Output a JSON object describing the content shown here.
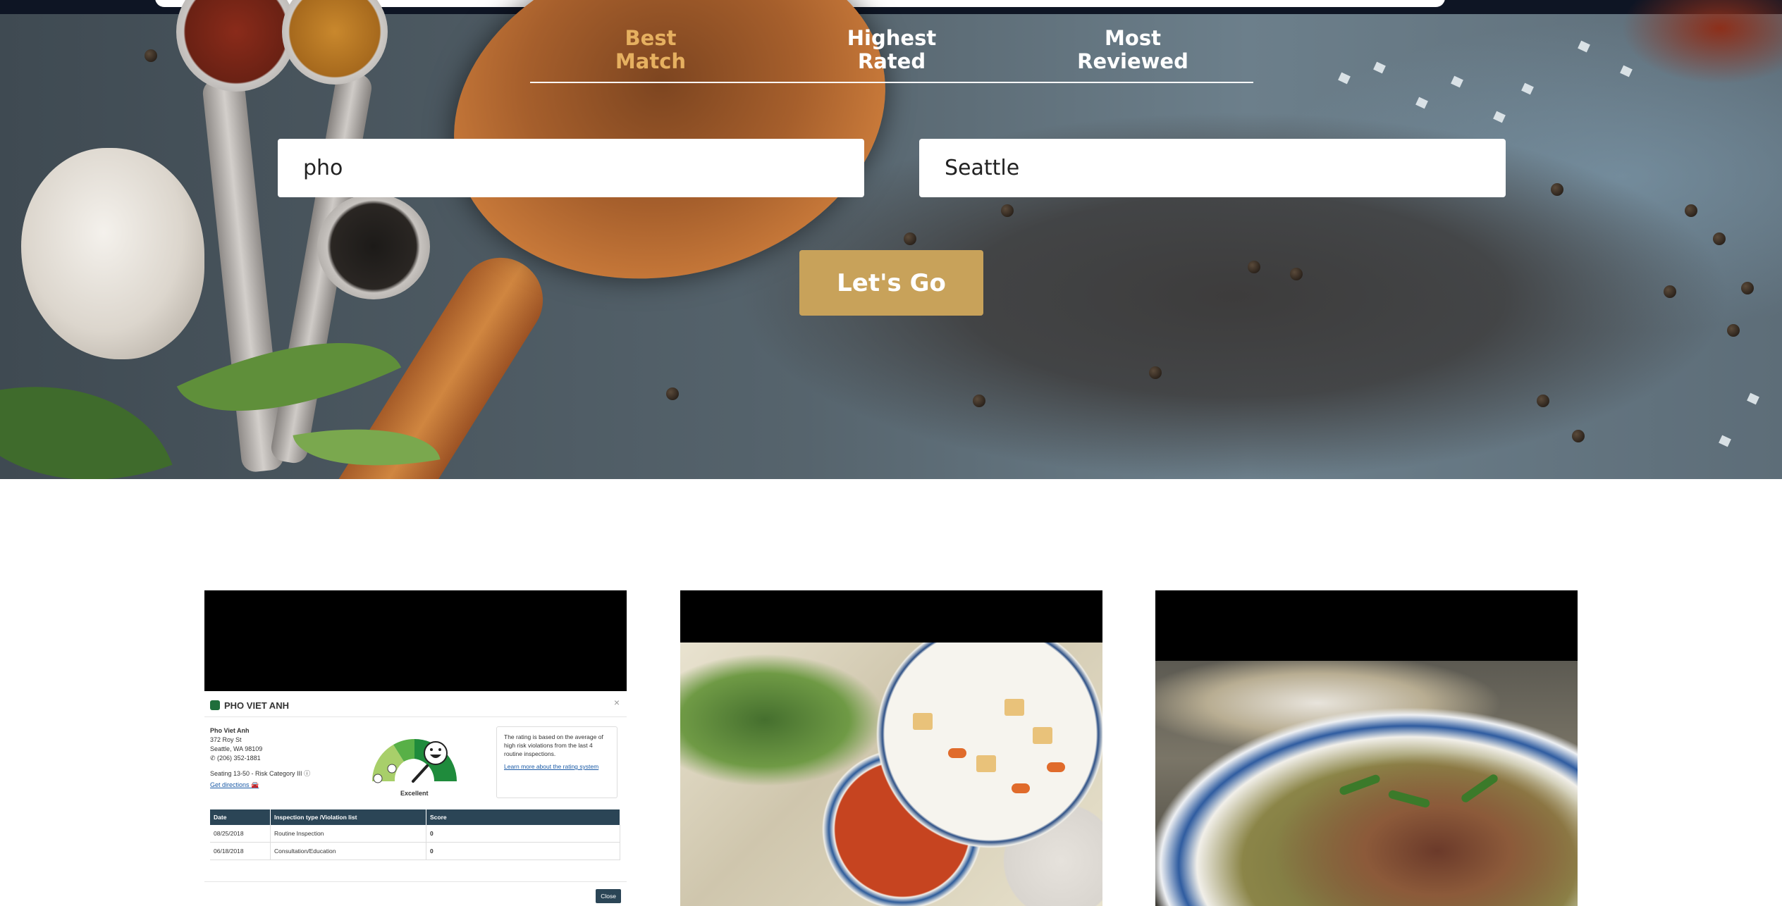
{
  "sort_tabs": [
    {
      "line1": "Best",
      "line2": "Match",
      "active": true
    },
    {
      "line1": "Highest",
      "line2": "Rated",
      "active": false
    },
    {
      "line1": "Most",
      "line2": "Reviewed",
      "active": false
    }
  ],
  "search": {
    "term_value": "pho",
    "location_value": "Seattle",
    "button_label": "Let's Go"
  },
  "colors": {
    "accent": "#c8a25a",
    "active_tab": "#e6b060",
    "header_dark": "#2b4556"
  },
  "results": [
    {
      "image": "inspection-report-screenshot",
      "inspection": {
        "title": "PHO VIET ANH",
        "close_x": "×",
        "name": "Pho Viet Anh",
        "street": "372 Roy St",
        "city": "Seattle, WA 98109",
        "phone": "(206) 352-1881",
        "seating": "Seating 13-50 - Risk Category III",
        "directions": "Get directions",
        "rating_label": "Excellent",
        "note_text": "The rating is based on the average of high risk violations from the last 4 routine inspections.",
        "note_link": "Learn more about the rating system",
        "table_headers": [
          "Date",
          "Inspection type /Violation list",
          "Score"
        ],
        "rows": [
          {
            "date": "08/25/2018",
            "type": "Routine Inspection",
            "score": "0"
          },
          {
            "date": "06/18/2018",
            "type": "Consultation/Education",
            "score": "0"
          }
        ],
        "close_button": "Close"
      }
    },
    {
      "image": "pho-table-photo"
    },
    {
      "image": "pho-bowl-closeup-photo"
    }
  ]
}
